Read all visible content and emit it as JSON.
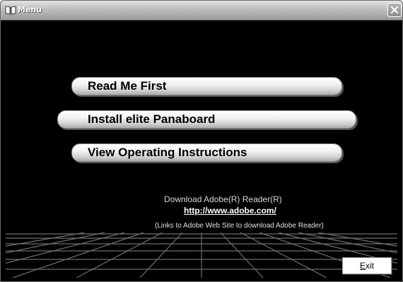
{
  "window": {
    "title": "Menu",
    "app_icon": "book-icon",
    "close_icon": "close-icon"
  },
  "menu": {
    "read_me_first": "Read Me First",
    "install": "Install elite Panaboard",
    "view_instructions": "View Operating Instructions"
  },
  "download": {
    "title": "Download Adobe(R) Reader(R)",
    "link": "http://www.adobe.com/",
    "note": "(Links to Adobe Web Site to download Adobe Reader)"
  },
  "exit": {
    "label_hotkey": "E",
    "label_rest": "xit"
  },
  "colors": {
    "background": "#000000",
    "button_face": "#f2f2f2",
    "titlebar": "#bdbdbd"
  }
}
